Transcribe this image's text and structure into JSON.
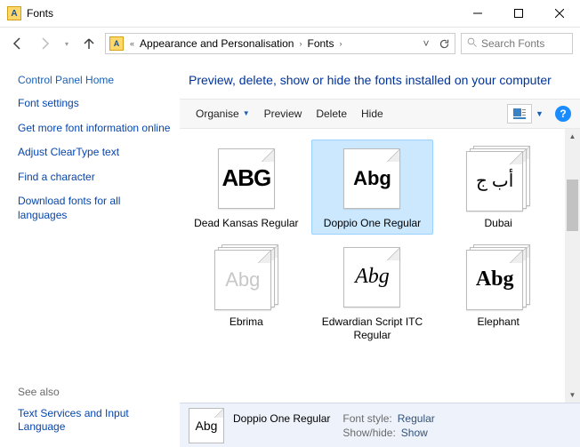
{
  "window": {
    "title": "Fonts"
  },
  "breadcrumb": {
    "seg1": "Appearance and Personalisation",
    "seg2": "Fonts"
  },
  "search": {
    "placeholder": "Search Fonts"
  },
  "sidebar": {
    "head": "Control Panel Home",
    "links": [
      "Font settings",
      "Get more font information online",
      "Adjust ClearType text",
      "Find a character",
      "Download fonts for all languages"
    ],
    "seealso": "See also",
    "seealso_link": "Text Services and Input Language"
  },
  "heading": "Preview, delete, show or hide the fonts installed on your computer",
  "toolbar": {
    "organise": "Organise",
    "preview": "Preview",
    "delete": "Delete",
    "hide": "Hide"
  },
  "fonts": [
    {
      "label": "Dead Kansas Regular",
      "sample": "ABG",
      "stack": false,
      "cls": "s-deadkansas"
    },
    {
      "label": "Doppio One Regular",
      "sample": "Abg",
      "stack": false,
      "cls": "s-doppio",
      "selected": true
    },
    {
      "label": "Dubai",
      "sample": "أب ج",
      "stack": true,
      "cls": "s-dubai"
    },
    {
      "label": "Ebrima",
      "sample": "Abg",
      "stack": true,
      "cls": "s-ebrima"
    },
    {
      "label": "Edwardian Script ITC Regular",
      "sample": "Abg",
      "stack": false,
      "cls": "s-edwardian"
    },
    {
      "label": "Elephant",
      "sample": "Abg",
      "stack": true,
      "cls": "s-elephant"
    }
  ],
  "details": {
    "name": "Doppio One Regular",
    "style_label": "Font style:",
    "style_value": "Regular",
    "show_label": "Show/hide:",
    "show_value": "Show",
    "sample": "Abg"
  }
}
